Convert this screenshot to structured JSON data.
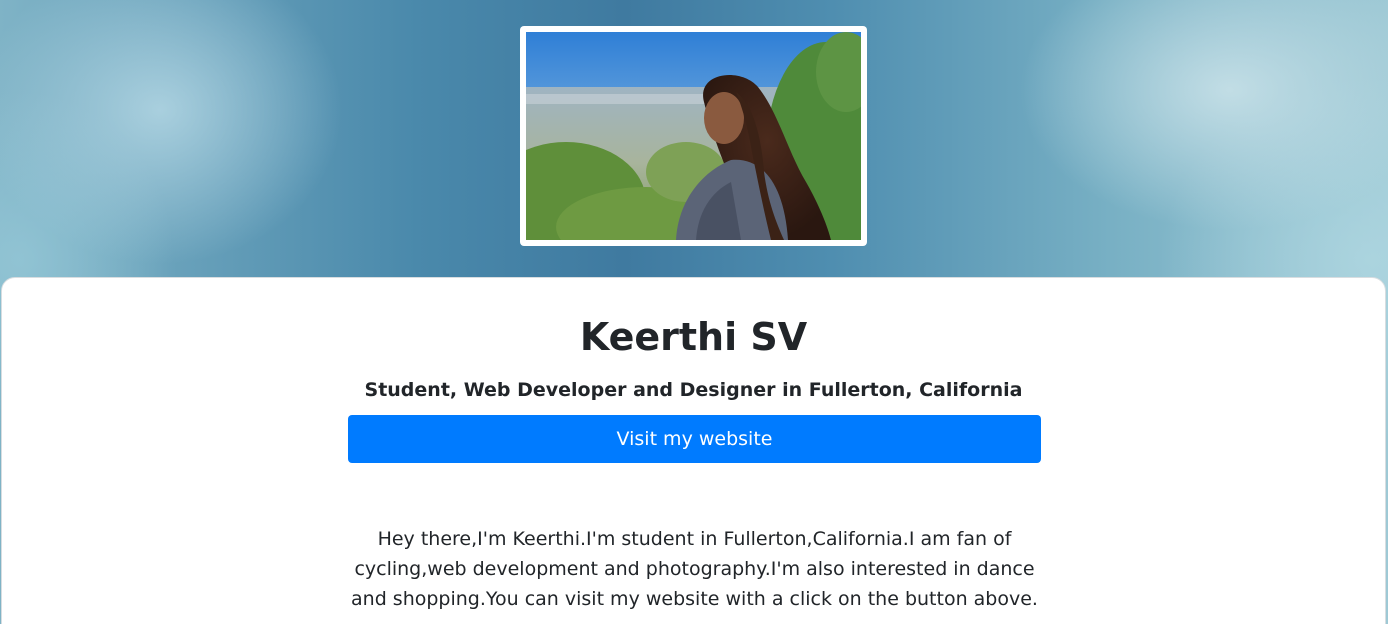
{
  "profile": {
    "photo_alt": "Portrait photo of Keerthi on a hillside overlooking a city",
    "name": "Keerthi SV",
    "tagline": "Student, Web Developer and Designer in Fullerton, California",
    "button_label": "Visit my website",
    "bio": "Hey there,I'm Keerthi.I'm student in Fullerton,California.I am fan of cycling,web development and photography.I'm also interested in dance and shopping.You can visit my website with a click on the button above."
  },
  "colors": {
    "accent": "#007bff",
    "text": "#212529",
    "card": "#ffffff"
  }
}
